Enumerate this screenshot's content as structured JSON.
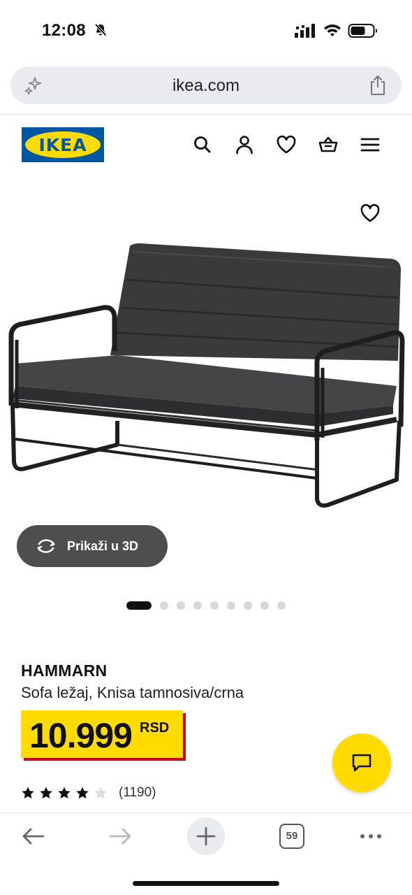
{
  "status_bar": {
    "time": "12:08",
    "icons": [
      "bell-slash-icon",
      "signal-icon",
      "wifi-icon",
      "battery-icon"
    ]
  },
  "browser": {
    "url": "ikea.com",
    "icons": [
      "sparkle-icon",
      "share-icon"
    ]
  },
  "header": {
    "logo_text": "IKEA",
    "icons": [
      "search-icon",
      "account-icon",
      "heart-icon",
      "basket-icon",
      "menu-icon"
    ]
  },
  "product": {
    "name": "HAMMARN",
    "description": "Sofa ležaj, Knisa tamnosiva/crna",
    "price": "10.999",
    "currency": "RSD",
    "view_3d_label": "Prikaži u 3D",
    "image_count": 9,
    "active_image": 1,
    "rating": 4,
    "rating_max": 5,
    "review_count": "(1190)"
  },
  "toolbar": {
    "tabs_count": "59",
    "icons": [
      "back-icon",
      "forward-icon",
      "new-tab-icon",
      "tabs-icon",
      "more-icon"
    ]
  },
  "colors": {
    "ikea_blue": "#0058a3",
    "ikea_yellow": "#ffdb00",
    "price_shadow": "#cc0008",
    "button_gray": "#4e4e4e"
  }
}
